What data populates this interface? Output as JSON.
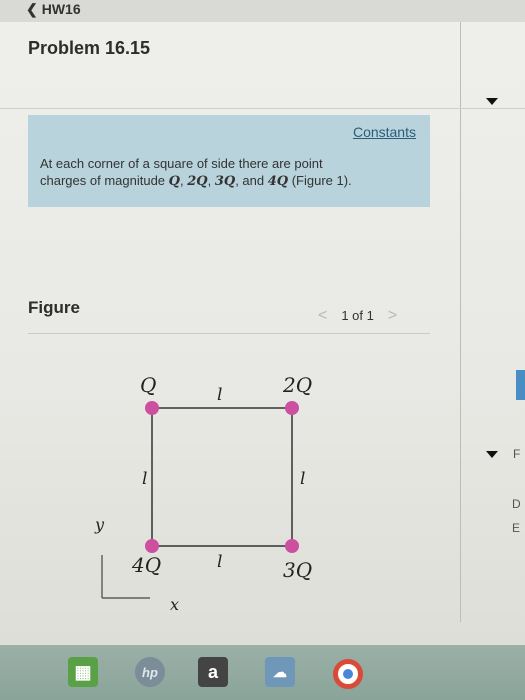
{
  "nav": {
    "back_label": "HW16"
  },
  "problem": {
    "title": "Problem 16.15",
    "constants_link": "Constants",
    "text_part1": "At each corner of a square of side there are point",
    "text_part2": "charges of magnitude ",
    "q1": "Q",
    "sep1": ", ",
    "q2": "2Q",
    "sep2": ", ",
    "q3": "3Q",
    "sep3": ", and ",
    "q4": "4Q",
    "text_end": " (Figure 1)."
  },
  "figure": {
    "label": "Figure",
    "pager_text": "1 of 1",
    "prev_symbol": "<",
    "next_symbol": ">",
    "charge_top_left": "Q",
    "charge_top_right": "2Q",
    "charge_bottom_right": "3Q",
    "charge_bottom_left": "4Q",
    "side_top": "l",
    "side_bottom": "l",
    "side_left": "l",
    "side_right": "l",
    "axis_x": "x",
    "axis_y": "y",
    "charge_color": "#cc4fa0"
  },
  "right_panel": {
    "letter_f": "F",
    "letter_d": "D",
    "letter_e": "E"
  },
  "taskbar": {
    "amazon_label": "a"
  }
}
